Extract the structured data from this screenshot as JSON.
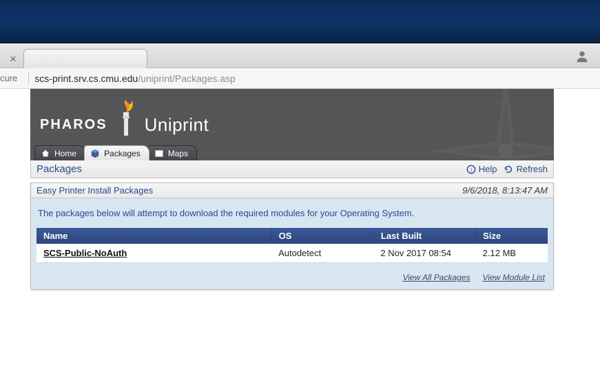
{
  "browser": {
    "secure_label": "cure",
    "url_host": "scs-print.srv.cs.cmu.edu",
    "url_path": "/uniprint/Packages.asp"
  },
  "banner": {
    "brand_left": "PHAROS",
    "brand_right": "Uniprint"
  },
  "nav": {
    "tabs": [
      {
        "label": "Home"
      },
      {
        "label": "Packages"
      },
      {
        "label": "Maps"
      }
    ]
  },
  "page": {
    "title": "Packages",
    "help_label": "Help",
    "refresh_label": "Refresh"
  },
  "panel": {
    "title": "Easy Printer Install Packages",
    "timestamp": "9/6/2018, 8:13:47 AM",
    "message": "The packages below will attempt to download the required modules for your Operating System.",
    "columns": {
      "name": "Name",
      "os": "OS",
      "last_built": "Last Built",
      "size": "Size"
    },
    "rows": [
      {
        "name": "SCS-Public-NoAuth",
        "os": "Autodetect",
        "last_built": "2 Nov 2017 08:54",
        "size": "2.12 MB"
      }
    ],
    "footer": {
      "view_all": "View All Packages",
      "view_modules": "View Module List"
    }
  }
}
